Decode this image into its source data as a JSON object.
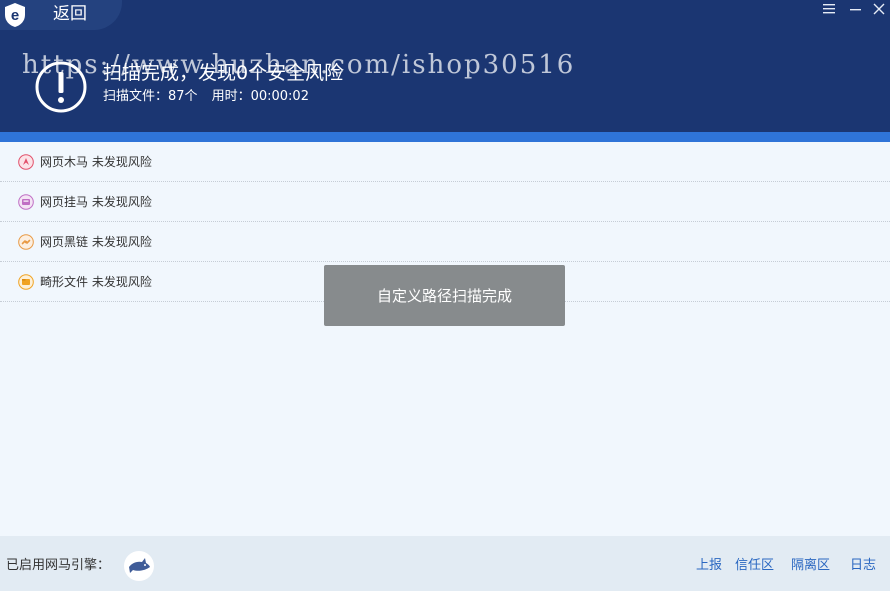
{
  "header": {
    "back_label": "返回",
    "title": "扫描完成，发现0个安全风险",
    "scanned_files_label": "扫描文件：",
    "scanned_files_value": "87个",
    "time_label": "用时：",
    "time_value": "00:00:02",
    "watermark": "https://www.huzhan.com/ishop30516"
  },
  "window_controls": [
    "menu-icon",
    "minimize-icon",
    "close-icon"
  ],
  "results": [
    {
      "icon": "webpage-trojan-icon",
      "label": "网页木马 未发现风险",
      "color": "#e2506a"
    },
    {
      "icon": "webpage-hang-trojan-icon",
      "label": "网页挂马 未发现风险",
      "color": "#c06fc4"
    },
    {
      "icon": "webpage-dark-link-icon",
      "label": "网页黑链 未发现风险",
      "color": "#e89a45"
    },
    {
      "icon": "malformed-file-icon",
      "label": "畸形文件 未发现风险",
      "color": "#f0a323"
    }
  ],
  "toast": {
    "text": "自定义路径扫描完成"
  },
  "footer": {
    "engine_label": "已启用网马引擎：",
    "engine_icon": "shark-engine-icon",
    "links": [
      "上报",
      "信任区",
      "隔离区",
      "日志"
    ]
  },
  "colors": {
    "header_bg": "#1b3672",
    "accent_stripe": "#2f74d8",
    "body_bg": "#f1f7fd",
    "footer_bg": "#e2ebf3",
    "link": "#2a67c1",
    "toast_bg": "#878b8d"
  }
}
